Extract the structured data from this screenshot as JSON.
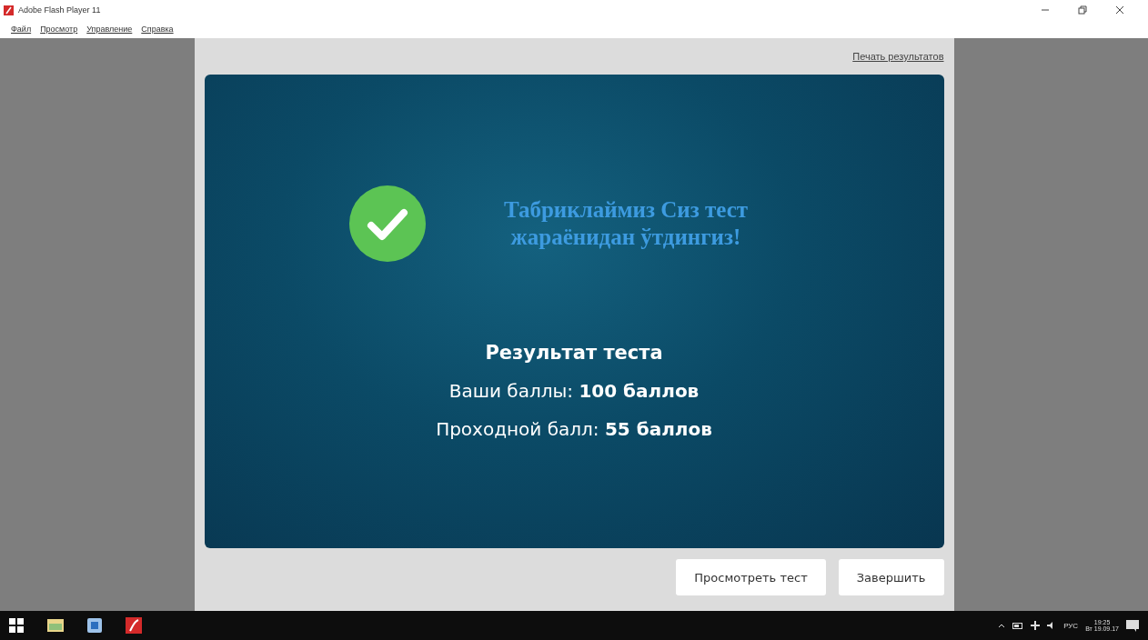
{
  "window": {
    "title": "Adobe Flash Player 11"
  },
  "menu": [
    "Файл",
    "Просмотр",
    "Управление",
    "Справка"
  ],
  "print_link": "Печать результатов",
  "result": {
    "heading": "Табриклаймиз Сиз тест жараёнидан ўтдингиз!",
    "title": "Результат теста",
    "lines": [
      {
        "label": "Ваши баллы: ",
        "value": "100 баллов"
      },
      {
        "label": "Проходной балл: ",
        "value": "55 баллов"
      }
    ]
  },
  "buttons": [
    "Просмотреть тест",
    "Завершить"
  ],
  "taskbar": {
    "language": "РУС",
    "time": "19:25",
    "date": "Вт 19.09.17"
  }
}
